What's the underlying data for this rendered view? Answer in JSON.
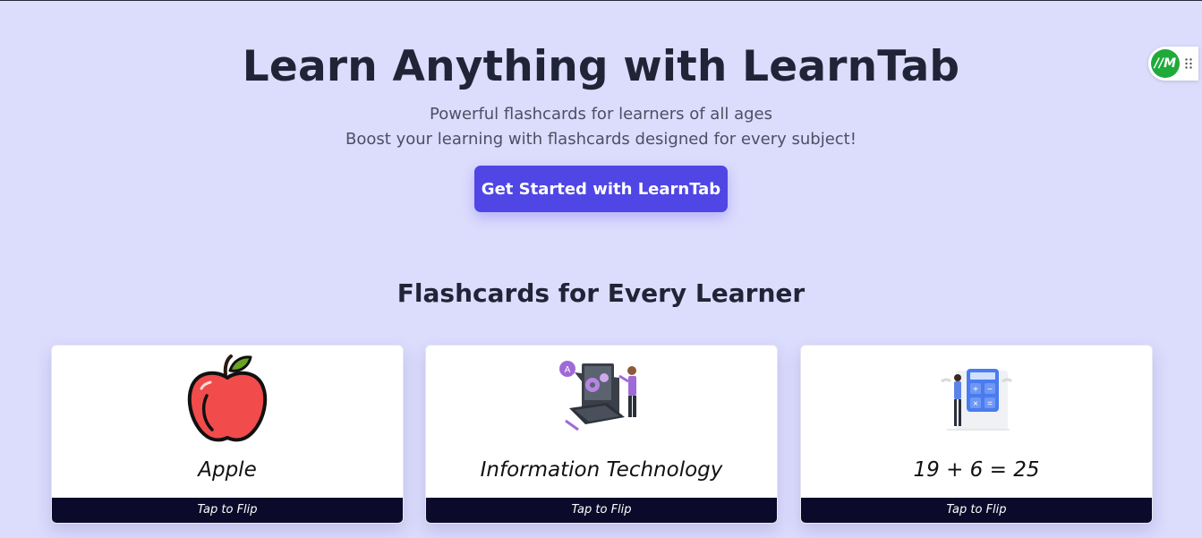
{
  "hero": {
    "title": "Learn Anything with LearnTab",
    "subtitle_1": "Powerful flashcards for learners of all ages",
    "subtitle_2": "Boost your learning with flashcards designed for every subject!",
    "cta_label": "Get Started with LearnTab"
  },
  "section": {
    "title": "Flashcards for Every Learner"
  },
  "cards": [
    {
      "label": "Apple",
      "flip_label": "Tap to Flip",
      "icon": "apple-icon"
    },
    {
      "label": "Information Technology",
      "flip_label": "Tap to Flip",
      "icon": "laptop-technician-illustration"
    },
    {
      "label": "19 + 6 = 25",
      "flip_label": "Tap to Flip",
      "icon": "calculator-illustration"
    }
  ],
  "widget": {
    "badge_text": "//M",
    "icon": "drag-grip-icon"
  },
  "colors": {
    "background": "#dcdcfd",
    "accent": "#4f46e5",
    "flip_bar": "#0c0a2b",
    "text": "#1f2537"
  }
}
